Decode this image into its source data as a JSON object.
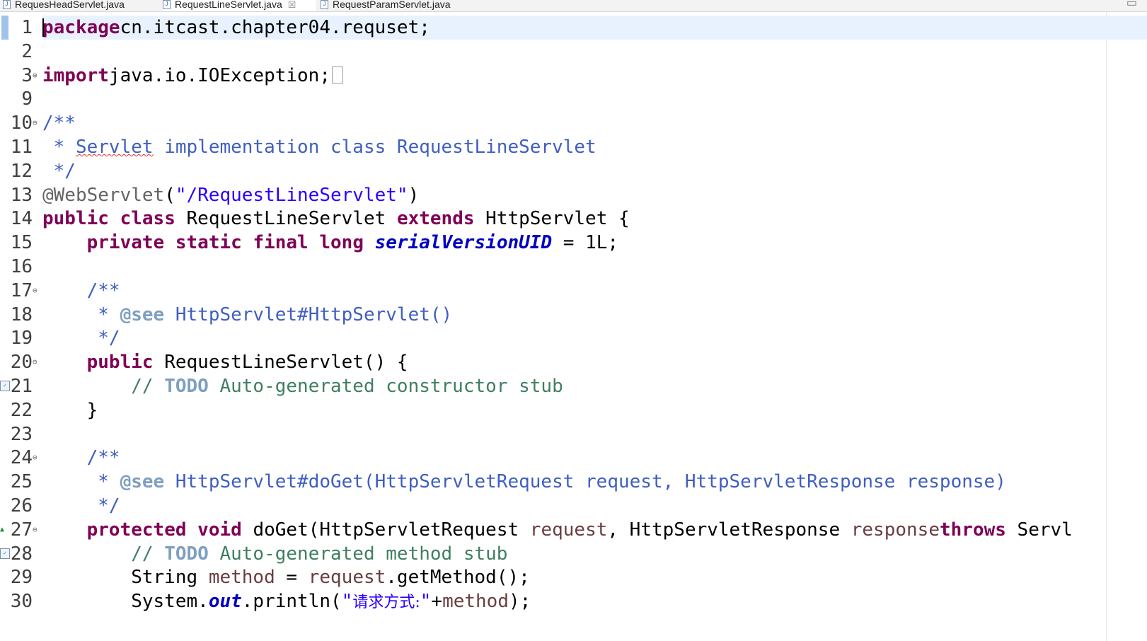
{
  "tabs": [
    {
      "label": "RequesHeadServlet.java",
      "icon": "java-file-icon",
      "active": false,
      "closable": false
    },
    {
      "label": "RequestLineServlet.java",
      "icon": "java-file-icon",
      "active": true,
      "closable": true
    },
    {
      "label": "RequestParamServlet.java",
      "icon": "java-file-icon",
      "active": false,
      "closable": false
    }
  ],
  "tab_icon_glyph": "J",
  "tab_close_glyph": "☒",
  "window_control_glyph": "▭",
  "editor": {
    "current_line": "1",
    "lines": [
      {
        "n": "1",
        "t": [
          [
            "kw",
            "package"
          ],
          [
            "",
            "cn.itcast.chapter04.requset;"
          ]
        ]
      },
      {
        "n": "2",
        "t": []
      },
      {
        "n": "3",
        "fold": "⊕",
        "t": [
          [
            "kw",
            "import"
          ],
          [
            "",
            "java.io.IOException;"
          ]
        ],
        "folded_box": true
      },
      {
        "n": "9",
        "t": []
      },
      {
        "n": "10",
        "fold": "⊖",
        "t": [
          [
            "jd",
            "/**"
          ]
        ]
      },
      {
        "n": "11",
        "t": [
          [
            "jd",
            " * "
          ],
          [
            "jd-squig",
            "Servlet"
          ],
          [
            "jd",
            " implementation class RequestLineServlet"
          ]
        ]
      },
      {
        "n": "12",
        "t": [
          [
            "jd",
            " */"
          ]
        ]
      },
      {
        "n": "13",
        "t": [
          [
            "ann-t",
            "@WebServlet"
          ],
          [
            "",
            "("
          ],
          [
            "str",
            "\"/RequestLineServlet\""
          ],
          [
            "",
            ")"
          ]
        ]
      },
      {
        "n": "14",
        "t": [
          [
            "kw",
            "public"
          ],
          [
            "",
            " "
          ],
          [
            "kw",
            "class"
          ],
          [
            "",
            " RequestLineServlet "
          ],
          [
            "kw",
            "extends"
          ],
          [
            "",
            " HttpServlet {"
          ]
        ]
      },
      {
        "n": "15",
        "t": [
          [
            "",
            "    "
          ],
          [
            "kw",
            "private"
          ],
          [
            "",
            " "
          ],
          [
            "kw",
            "static"
          ],
          [
            "",
            " "
          ],
          [
            "kw",
            "final"
          ],
          [
            "",
            " "
          ],
          [
            "kw",
            "long"
          ],
          [
            "",
            " "
          ],
          [
            "fld",
            "serialVersionUID"
          ],
          [
            "",
            " = 1L;"
          ]
        ]
      },
      {
        "n": "16",
        "t": []
      },
      {
        "n": "17",
        "fold": "⊖",
        "t": [
          [
            "jd",
            "    /**"
          ]
        ]
      },
      {
        "n": "18",
        "t": [
          [
            "jd",
            "     * "
          ],
          [
            "tag",
            "@see"
          ],
          [
            "jd",
            " HttpServlet#HttpServlet()"
          ]
        ]
      },
      {
        "n": "19",
        "t": [
          [
            "jd",
            "     */"
          ]
        ]
      },
      {
        "n": "20",
        "fold": "⊖",
        "t": [
          [
            "",
            "    "
          ],
          [
            "kw",
            "public"
          ],
          [
            "",
            " RequestLineServlet() {"
          ]
        ]
      },
      {
        "n": "21",
        "task": true,
        "t": [
          [
            "cmt",
            "        // "
          ],
          [
            "tag",
            "TODO"
          ],
          [
            "cmt",
            " Auto-generated constructor stub"
          ]
        ]
      },
      {
        "n": "22",
        "t": [
          [
            "",
            "    }"
          ]
        ]
      },
      {
        "n": "23",
        "t": []
      },
      {
        "n": "24",
        "fold": "⊖",
        "t": [
          [
            "jd",
            "    /**"
          ]
        ]
      },
      {
        "n": "25",
        "t": [
          [
            "jd",
            "     * "
          ],
          [
            "tag",
            "@see"
          ],
          [
            "jd",
            " HttpServlet#doGet(HttpServletRequest request, HttpServletResponse response)"
          ]
        ]
      },
      {
        "n": "26",
        "t": [
          [
            "jd",
            "     */"
          ]
        ]
      },
      {
        "n": "27",
        "fold": "⊖",
        "override": true,
        "t": [
          [
            "",
            "    "
          ],
          [
            "kw",
            "protected"
          ],
          [
            "",
            " "
          ],
          [
            "kw",
            "void"
          ],
          [
            "",
            " doGet(HttpServletRequest "
          ],
          [
            "par",
            "request"
          ],
          [
            "",
            ", HttpServletResponse "
          ],
          [
            "par",
            "response"
          ],
          [
            ") "
          ],
          [
            "kw",
            "throws"
          ],
          [
            "",
            " Servl"
          ]
        ]
      },
      {
        "n": "28",
        "task": true,
        "t": [
          [
            "cmt",
            "        // "
          ],
          [
            "tag",
            "TODO"
          ],
          [
            "cmt",
            " Auto-generated method stub"
          ]
        ]
      },
      {
        "n": "29",
        "t": [
          [
            "",
            "        String "
          ],
          [
            "par",
            "method"
          ],
          [
            "",
            " = "
          ],
          [
            "par",
            "request"
          ],
          [
            "",
            ".getMethod();"
          ]
        ]
      },
      {
        "n": "30",
        "t": [
          [
            "",
            "        System."
          ],
          [
            "fld",
            "out"
          ],
          [
            "",
            ".println("
          ],
          [
            "str",
            "\""
          ],
          [
            "str-cjk",
            "请求方式:"
          ],
          [
            "str",
            "\""
          ],
          [
            "",
            "+"
          ],
          [
            "par",
            "method"
          ],
          [
            "",
            ");"
          ]
        ]
      }
    ]
  },
  "icons": {
    "fold_expand": "plus-fold-icon",
    "fold_collapse": "minus-fold-icon",
    "task_marker": "task-marker-icon",
    "override_marker": "override-arrow-icon",
    "override_glyph": "▲",
    "task_glyph": "✓"
  },
  "colors": {
    "keyword": "#7f0055",
    "string": "#2a00ff",
    "comment": "#3f7f5f",
    "javadoc": "#3f5fbf",
    "javadoc_tag": "#7f9fbf",
    "field": "#0000c0",
    "parameter": "#6a3e3e",
    "current_line": "#e8f2fe"
  }
}
